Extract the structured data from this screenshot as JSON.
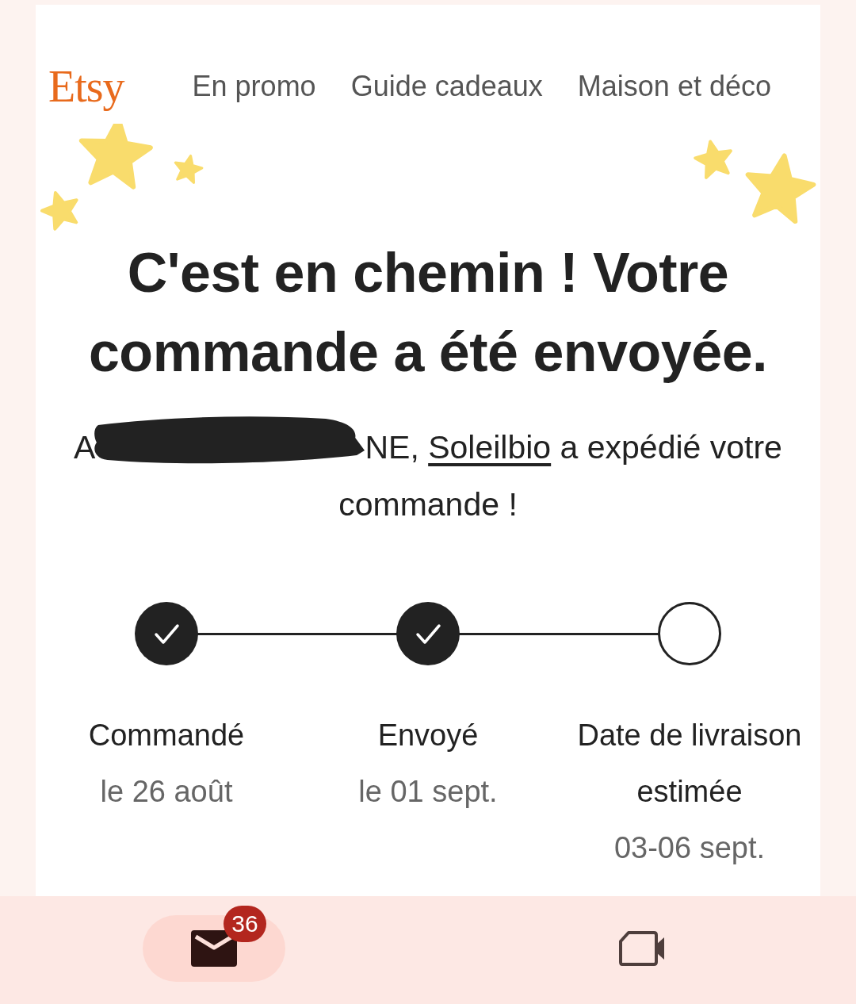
{
  "header": {
    "logo": "Etsy",
    "nav": [
      "En promo",
      "Guide cadeaux",
      "Maison et déco"
    ]
  },
  "title": "C'est en chemin ! Votre commande a été envoyée.",
  "greeting": {
    "start": "A",
    "name_end": "NE,",
    "shop": "Soleilbio",
    "rest": "a expédié votre commande !"
  },
  "steps": [
    {
      "label": "Commandé",
      "date": "le 26 août",
      "done": true
    },
    {
      "label": "Envoyé",
      "date": "le 01 sept.",
      "done": true
    },
    {
      "label": "Date de livraison estimée",
      "date": "03-06 sept.",
      "done": false
    }
  ],
  "bottom_nav": [
    {
      "kind": "mail",
      "badge": "36",
      "selected": true
    },
    {
      "kind": "video",
      "selected": false
    }
  ]
}
